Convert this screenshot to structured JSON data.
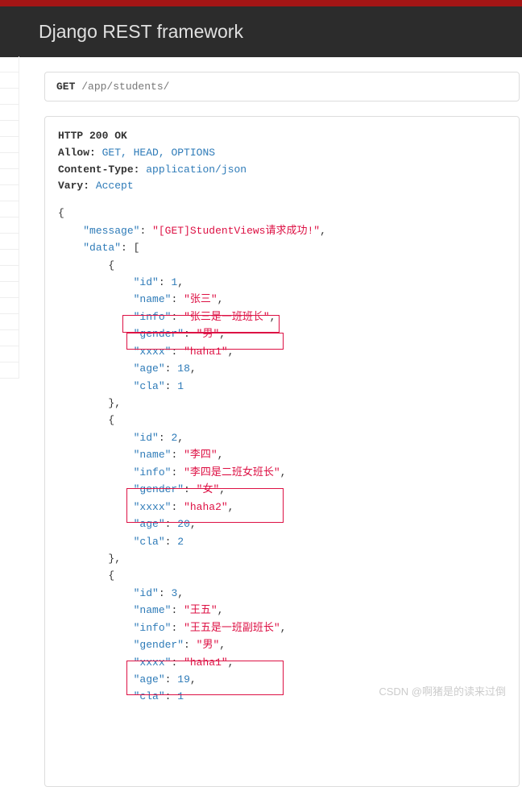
{
  "header": {
    "title": "Django REST framework"
  },
  "request": {
    "method": "GET",
    "path": "/app/students/"
  },
  "response": {
    "status_line": "HTTP 200 OK",
    "headers": {
      "allow_key": "Allow:",
      "allow_val": "GET, HEAD, OPTIONS",
      "ctype_key": "Content-Type:",
      "ctype_val": "application/json",
      "vary_key": "Vary:",
      "vary_val": "Accept"
    }
  },
  "watermark": "CSDN @啊猪是的读来过倒",
  "body": {
    "message_key": "\"message\"",
    "message_val": "\"[GET]StudentViews请求成功!\"",
    "data_key": "\"data\"",
    "items": [
      {
        "id_key": "\"id\"",
        "id_val": "1",
        "name_key": "\"name\"",
        "name_val": "\"张三\"",
        "info_key": "\"info\"",
        "info_val": "\"张三是一班班长\"",
        "gender_key": "\"gender\"",
        "gender_val": "\"男\"",
        "xxxx_key": "\"xxxx\"",
        "xxxx_val": "\"haha1\"",
        "age_key": "\"age\"",
        "age_val": "18",
        "cla_key": "\"cla\"",
        "cla_val": "1"
      },
      {
        "id_key": "\"id\"",
        "id_val": "2",
        "name_key": "\"name\"",
        "name_val": "\"李四\"",
        "info_key": "\"info\"",
        "info_val": "\"李四是二班女班长\"",
        "gender_key": "\"gender\"",
        "gender_val": "\"女\"",
        "xxxx_key": "\"xxxx\"",
        "xxxx_val": "\"haha2\"",
        "age_key": "\"age\"",
        "age_val": "20",
        "cla_key": "\"cla\"",
        "cla_val": "2"
      },
      {
        "id_key": "\"id\"",
        "id_val": "3",
        "name_key": "\"name\"",
        "name_val": "\"王五\"",
        "info_key": "\"info\"",
        "info_val": "\"王五是一班副班长\"",
        "gender_key": "\"gender\"",
        "gender_val": "\"男\"",
        "xxxx_key": "\"xxxx\"",
        "xxxx_val": "\"haha1\"",
        "age_key": "\"age\"",
        "age_val": "19",
        "cla_key": "\"cla\"",
        "cla_val": "1"
      }
    ]
  }
}
